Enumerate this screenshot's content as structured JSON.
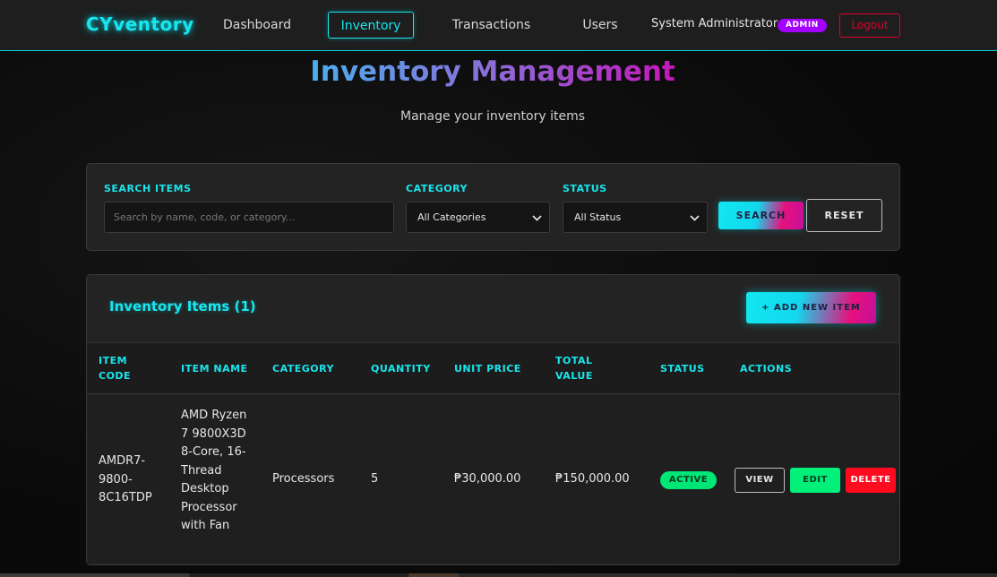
{
  "nav": {
    "brand": "CYventory",
    "links": [
      {
        "label": "Dashboard"
      },
      {
        "label": "Inventory"
      },
      {
        "label": "Transactions"
      },
      {
        "label": "Users"
      }
    ],
    "user_name": "System Administrator",
    "role_badge": "ADMIN",
    "logout_label": "Logout"
  },
  "header": {
    "title": "Inventory Management",
    "subtitle": "Manage your inventory items"
  },
  "filters": {
    "search_label": "SEARCH ITEMS",
    "search_placeholder": "Search by name, code, or category...",
    "search_value": "",
    "category_label": "CATEGORY",
    "category_selected": "All Categories",
    "status_label": "STATUS",
    "status_selected": "All Status",
    "search_button": "SEARCH",
    "reset_button": "RESET"
  },
  "items": {
    "heading": "Inventory Items (1)",
    "add_button": "+ ADD NEW ITEM",
    "columns": [
      "ITEM CODE",
      "ITEM NAME",
      "CATEGORY",
      "QUANTITY",
      "UNIT PRICE",
      "TOTAL VALUE",
      "STATUS",
      "ACTIONS"
    ],
    "rows": [
      {
        "code": "AMDR7-9800-8C16TDP",
        "name": "AMD Ryzen 7 9800X3D 8-Core, 16-Thread Desktop Processor with Fan",
        "category": "Processors",
        "quantity": "5",
        "unit_price": "₱30,000.00",
        "total_value": "₱150,000.00",
        "status": "ACTIVE",
        "actions": {
          "view": "VIEW",
          "edit": "EDIT",
          "delete": "DELETE"
        }
      }
    ]
  },
  "colors": {
    "accent": "#18e6ee",
    "admin_badge": "#a300ff",
    "logout": "#e0002a",
    "active_status": "#00e676",
    "edit_button": "#00f07a",
    "delete_button": "#ff0a1f"
  }
}
